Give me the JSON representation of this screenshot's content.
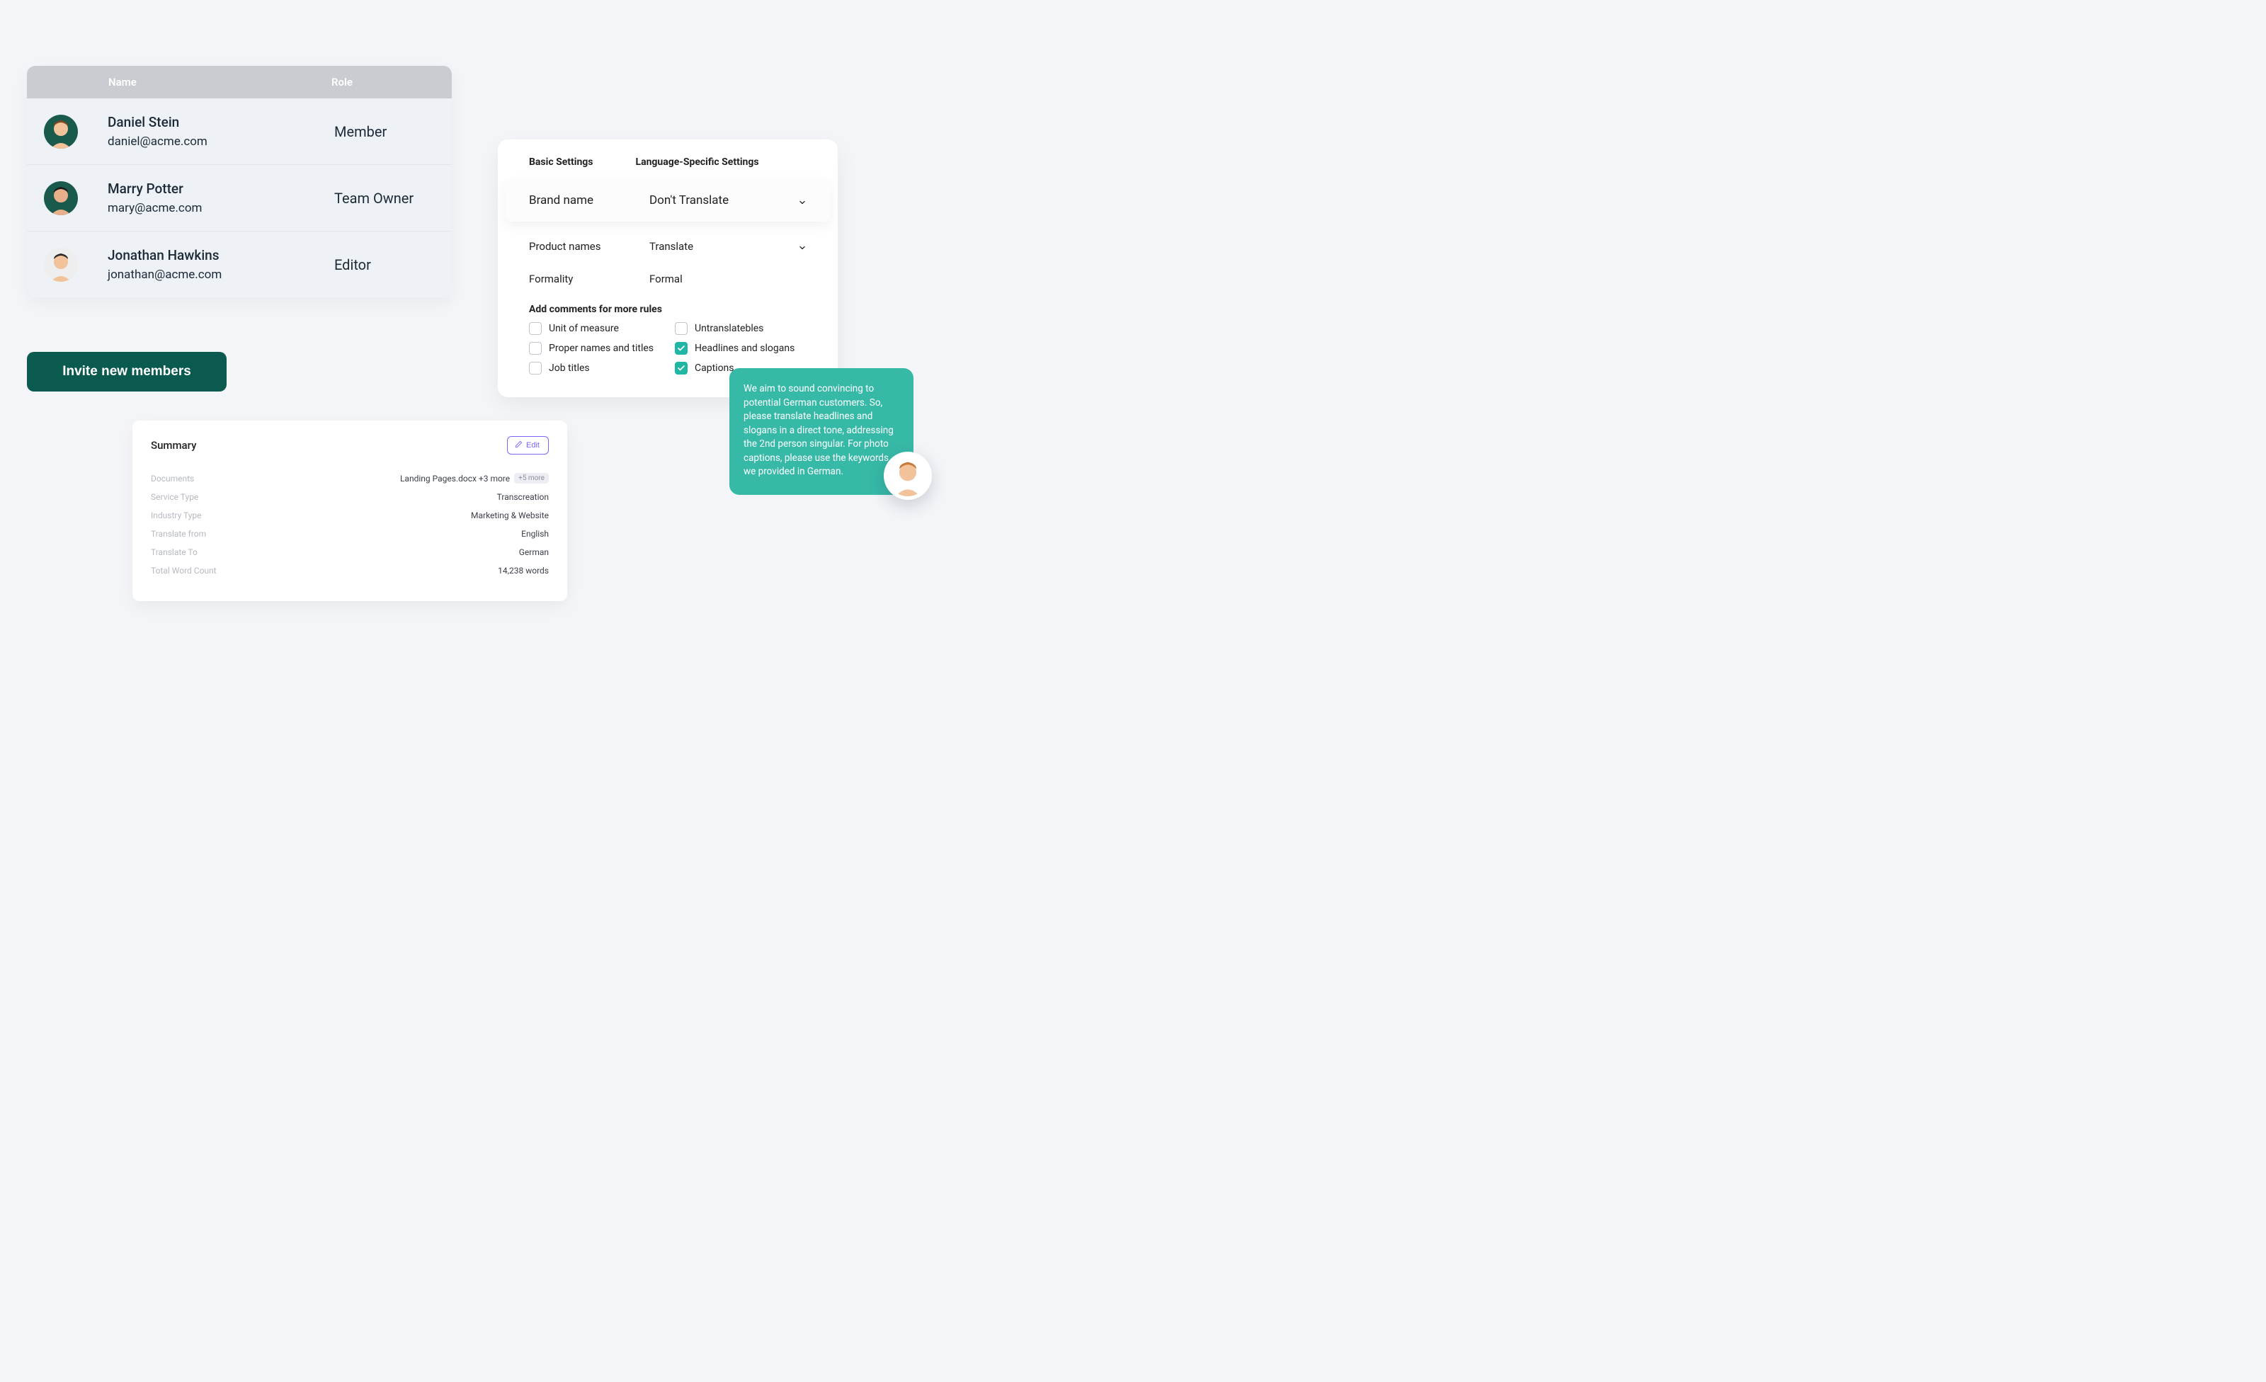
{
  "team": {
    "headers": {
      "name": "Name",
      "role": "Role"
    },
    "members": [
      {
        "name": "Daniel Stein",
        "email": "daniel@acme.com",
        "role": "Member",
        "avatar_bg": "#1a5a4d",
        "skin": "#f2c29b",
        "hair": "#7a4a25"
      },
      {
        "name": "Marry Potter",
        "email": "mary@acme.com",
        "role": "Team Owner",
        "avatar_bg": "#1a5a4d",
        "skin": "#e8b08a",
        "hair": "#1a1a1a"
      },
      {
        "name": "Jonathan Hawkins",
        "email": "jonathan@acme.com",
        "role": "Editor",
        "avatar_bg": "#eeeeee",
        "skin": "#f2c29b",
        "hair": "#2b2b2b"
      }
    ],
    "invite_button": "Invite new members"
  },
  "settings": {
    "tabs": [
      "Basic Settings",
      "Language-Specific Settings"
    ],
    "rows": [
      {
        "label": "Brand name",
        "value": "Don't Translate",
        "featured": true,
        "has_chevron": true
      },
      {
        "label": "Product names",
        "value": "Translate",
        "featured": false,
        "has_chevron": true
      },
      {
        "label": "Formality",
        "value": "Formal",
        "featured": false,
        "has_chevron": false
      }
    ],
    "comments_title": "Add comments for more rules",
    "checkboxes": [
      {
        "label": "Unit of measure",
        "checked": false
      },
      {
        "label": "Untranslatebles",
        "checked": false
      },
      {
        "label": "Proper names and titles",
        "checked": false
      },
      {
        "label": "Headlines and slogans",
        "checked": true
      },
      {
        "label": "Job titles",
        "checked": false
      },
      {
        "label": "Captions",
        "checked": true
      }
    ]
  },
  "comment": {
    "text": "We aim to sound convincing to potential German customers. So, please translate headlines and slogans in a direct tone, addressing the 2nd person singular. For photo captions, please use the keywords we provided in German.",
    "avatar_bg": "#ffffff",
    "skin": "#f2c29b",
    "hair": "#c67b3b"
  },
  "summary": {
    "title": "Summary",
    "edit_label": "Edit",
    "items": [
      {
        "label": "Documents",
        "value": "Landing Pages.docx +3 more",
        "pill": "+5 more"
      },
      {
        "label": "Service Type",
        "value": "Transcreation"
      },
      {
        "label": "Industry Type",
        "value": "Marketing & Website"
      },
      {
        "label": "Translate from",
        "value": "English"
      },
      {
        "label": "Translate To",
        "value": "German"
      },
      {
        "label": "Total Word Count",
        "value": "14,238 words"
      }
    ]
  }
}
